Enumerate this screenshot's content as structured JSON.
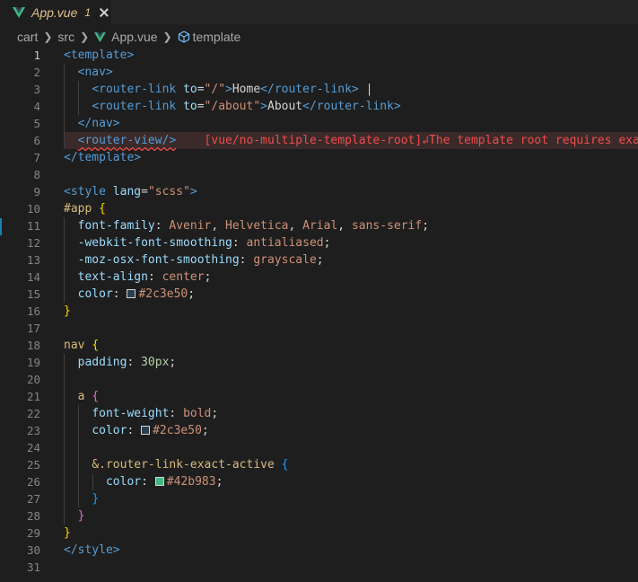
{
  "tab": {
    "label": "App.vue",
    "count": "1"
  },
  "breadcrumb": {
    "c1": "cart",
    "c2": "src",
    "c3": "App.vue",
    "c4": "template"
  },
  "line_numbers": [
    "1",
    "2",
    "3",
    "4",
    "5",
    "6",
    "7",
    "8",
    "9",
    "10",
    "11",
    "12",
    "13",
    "14",
    "15",
    "16",
    "17",
    "18",
    "19",
    "20",
    "21",
    "22",
    "23",
    "24",
    "25",
    "26",
    "27",
    "28",
    "29",
    "30",
    "31"
  ],
  "code": {
    "l1": {
      "open": "<template>"
    },
    "l2": {
      "open": "<nav>"
    },
    "l3": {
      "lt": "<router-link",
      "attr": "to",
      "eq": "=",
      "val": "\"/\"",
      "gt": ">",
      "text": "Home",
      "close": "</router-link>",
      "pipe": " |"
    },
    "l4": {
      "lt": "<router-link",
      "attr": "to",
      "eq": "=",
      "val": "\"/about\"",
      "gt": ">",
      "text": "About",
      "close": "</router-link>"
    },
    "l5": {
      "close": "</nav>"
    },
    "l6": {
      "tag": "<router-view/>",
      "error": "[vue/no-multiple-template-root]↲The template root requires exac"
    },
    "l7": {
      "close": "</template>"
    },
    "l9": {
      "lt": "<style",
      "attr": "lang",
      "eq": "=",
      "val": "\"scss\"",
      "gt": ">"
    },
    "l10": {
      "sel": "#app",
      "brace": "{"
    },
    "l11": {
      "prop": "font-family",
      "v1": "Avenir",
      "v2": "Helvetica",
      "v3": "Arial",
      "v4": "sans-serif"
    },
    "l12": {
      "prop": "-webkit-font-smoothing",
      "val": "antialiased"
    },
    "l13": {
      "prop": "-moz-osx-font-smoothing",
      "val": "grayscale"
    },
    "l14": {
      "prop": "text-align",
      "val": "center"
    },
    "l15": {
      "prop": "color",
      "val": "#2c3e50"
    },
    "l16": {
      "brace": "}"
    },
    "l18": {
      "sel": "nav",
      "brace": "{"
    },
    "l19": {
      "prop": "padding",
      "val": "30px"
    },
    "l21": {
      "sel": "a",
      "brace": "{"
    },
    "l22": {
      "prop": "font-weight",
      "val": "bold"
    },
    "l23": {
      "prop": "color",
      "val": "#2c3e50"
    },
    "l25": {
      "sel": "&.router-link-exact-active",
      "brace": "{"
    },
    "l26": {
      "prop": "color",
      "val": "#42b983"
    },
    "l27": {
      "brace": "}"
    },
    "l28": {
      "brace": "}"
    },
    "l29": {
      "brace": "}"
    },
    "l30": {
      "close": "</style>"
    }
  },
  "colors": {
    "swatch_dark": "#2c3e50",
    "swatch_green": "#42b983",
    "vue_green": "#41b883"
  }
}
